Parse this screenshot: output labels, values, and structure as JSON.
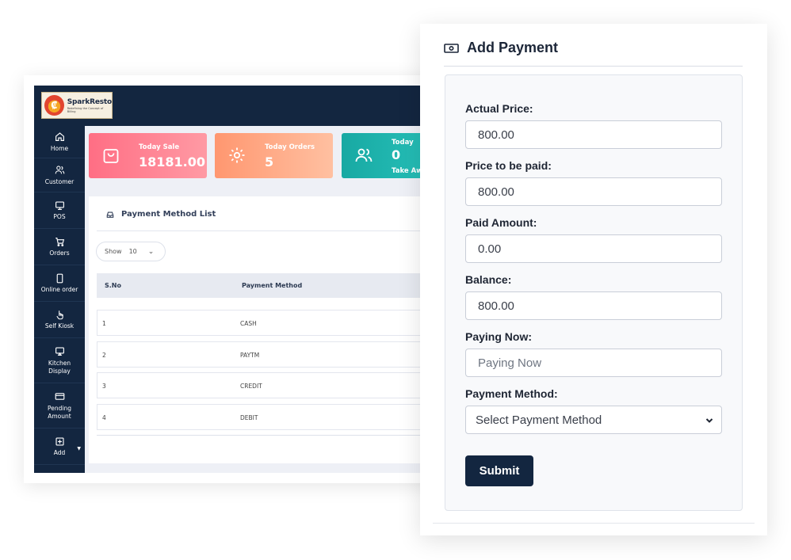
{
  "app": {
    "brand": {
      "name": "SparkResto",
      "tagline": "Redefining the Concept of Billing"
    },
    "sidebar": {
      "items": [
        {
          "label": "Home",
          "icon": "home-icon"
        },
        {
          "label": "Customer",
          "icon": "users-icon"
        },
        {
          "label": "POS",
          "icon": "monitor-icon"
        },
        {
          "label": "Orders",
          "icon": "cart-icon"
        },
        {
          "label": "Online order",
          "icon": "mobile-icon"
        },
        {
          "label": "Self Kiosk",
          "icon": "hand-pointer-icon"
        },
        {
          "label": "Kitchen Display",
          "icon": "display-icon"
        },
        {
          "label": "Pending Amount",
          "icon": "card-icon"
        },
        {
          "label": "Add",
          "icon": "plus-square-icon"
        }
      ]
    },
    "stats": [
      {
        "label": "Today Sale",
        "value": "18181.00",
        "icon": "shopping-bag-icon",
        "color": "#ff6e84"
      },
      {
        "label": "Today Orders",
        "value": "5",
        "icon": "gear-icon",
        "color": "#ff9770"
      },
      {
        "label": "Today",
        "value": "0",
        "sub": "Take Aw",
        "icon": "users-icon",
        "color": "#18a9a3"
      }
    ],
    "payment_method_list": {
      "title": "Payment Method List",
      "show_label": "Show",
      "show_value": "10",
      "columns": [
        "S.No",
        "Payment Method"
      ],
      "rows": [
        {
          "sno": "1",
          "method": "CASH"
        },
        {
          "sno": "2",
          "method": "PAYTM"
        },
        {
          "sno": "3",
          "method": "CREDIT"
        },
        {
          "sno": "4",
          "method": "DEBIT"
        }
      ]
    }
  },
  "add_payment": {
    "title": "Add Payment",
    "fields": {
      "actual_price": {
        "label": "Actual Price:",
        "value": "800.00"
      },
      "price_to_be_paid": {
        "label": "Price to be paid:",
        "value": "800.00"
      },
      "paid_amount": {
        "label": "Paid Amount:",
        "value": "0.00"
      },
      "balance": {
        "label": "Balance:",
        "value": "800.00"
      },
      "paying_now": {
        "label": "Paying Now:",
        "placeholder": "Paying Now"
      },
      "payment_method": {
        "label": "Payment Method:",
        "selected": "Select Payment Method"
      }
    },
    "submit_label": "Submit"
  },
  "colors": {
    "navy": "#132640",
    "sale_card": "#ff6e84",
    "orders_card": "#ff9770",
    "today_card": "#18a9a3"
  }
}
